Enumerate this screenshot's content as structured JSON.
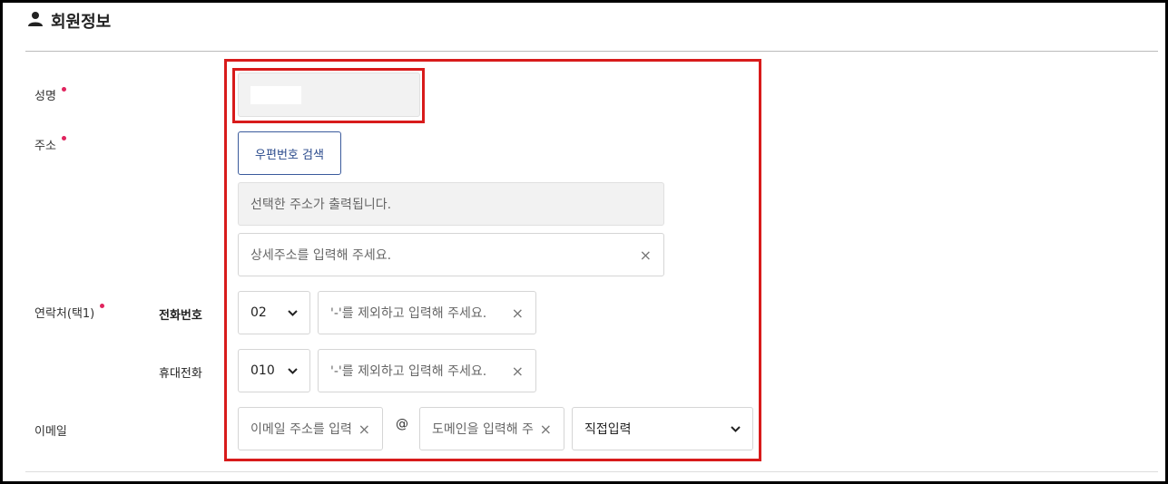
{
  "section": {
    "title": "회원정보",
    "icon": "user-icon"
  },
  "labels": {
    "name": "성명",
    "address": "주소",
    "contact": "연락처(택1)",
    "email": "이메일"
  },
  "contact": {
    "phone_label": "전화번호",
    "mobile_label": "휴대전화",
    "phone_prefix": "02",
    "mobile_prefix": "010",
    "phone_placeholder": "'-'를 제외하고 입력해 주세요.",
    "mobile_placeholder": "'-'를 제외하고 입력해 주세요."
  },
  "address": {
    "search_button": "우편번호 검색",
    "selected_placeholder": "선택한 주소가 출력됩니다.",
    "detail_placeholder": "상세주소를 입력해 주세요."
  },
  "email": {
    "id_placeholder": "이메일 주소를 입력",
    "at": "@",
    "domain_placeholder": "도메인을 입력해 주",
    "domain_select": "직접입력"
  },
  "colors": {
    "required_dot": "#e0245e",
    "highlight": "#d81b1b",
    "button": "#2a4a8c"
  }
}
